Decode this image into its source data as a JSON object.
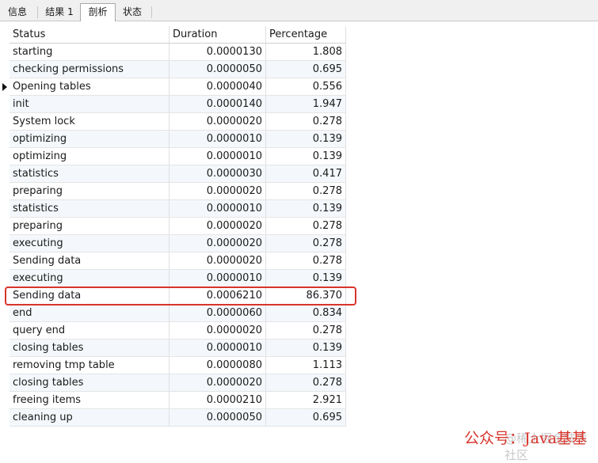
{
  "tabs": [
    {
      "label": "信息"
    },
    {
      "label": "结果 1"
    },
    {
      "label": "剖析"
    },
    {
      "label": "状态"
    }
  ],
  "active_tab": "剖析",
  "columns": [
    "Status",
    "Duration",
    "Percentage"
  ],
  "rows": [
    {
      "status": "starting",
      "duration": "0.0000130",
      "percentage": "1.808"
    },
    {
      "status": "checking permissions",
      "duration": "0.0000050",
      "percentage": "0.695"
    },
    {
      "status": "Opening tables",
      "duration": "0.0000040",
      "percentage": "0.556"
    },
    {
      "status": "init",
      "duration": "0.0000140",
      "percentage": "1.947"
    },
    {
      "status": "System lock",
      "duration": "0.0000020",
      "percentage": "0.278"
    },
    {
      "status": "optimizing",
      "duration": "0.0000010",
      "percentage": "0.139"
    },
    {
      "status": "optimizing",
      "duration": "0.0000010",
      "percentage": "0.139"
    },
    {
      "status": "statistics",
      "duration": "0.0000030",
      "percentage": "0.417"
    },
    {
      "status": "preparing",
      "duration": "0.0000020",
      "percentage": "0.278"
    },
    {
      "status": "statistics",
      "duration": "0.0000010",
      "percentage": "0.139"
    },
    {
      "status": "preparing",
      "duration": "0.0000020",
      "percentage": "0.278"
    },
    {
      "status": "executing",
      "duration": "0.0000020",
      "percentage": "0.278"
    },
    {
      "status": "Sending data",
      "duration": "0.0000020",
      "percentage": "0.278"
    },
    {
      "status": "executing",
      "duration": "0.0000010",
      "percentage": "0.139"
    },
    {
      "status": "Sending data",
      "duration": "0.0006210",
      "percentage": "86.370"
    },
    {
      "status": "end",
      "duration": "0.0000060",
      "percentage": "0.834"
    },
    {
      "status": "query end",
      "duration": "0.0000020",
      "percentage": "0.278"
    },
    {
      "status": "closing tables",
      "duration": "0.0000010",
      "percentage": "0.139"
    },
    {
      "status": "removing tmp table",
      "duration": "0.0000080",
      "percentage": "1.113"
    },
    {
      "status": "closing tables",
      "duration": "0.0000020",
      "percentage": "0.278"
    },
    {
      "status": "freeing items",
      "duration": "0.0000210",
      "percentage": "2.921"
    },
    {
      "status": "cleaning up",
      "duration": "0.0000050",
      "percentage": "0.695"
    }
  ],
  "current_row_index": 2,
  "highlight_row_index": 14,
  "colors": {
    "highlight": "#d9342b",
    "alt_row": "#f4f8fc"
  },
  "watermark_faint": "@稀土掘金技术社区",
  "watermark": "公众号：Java基基"
}
